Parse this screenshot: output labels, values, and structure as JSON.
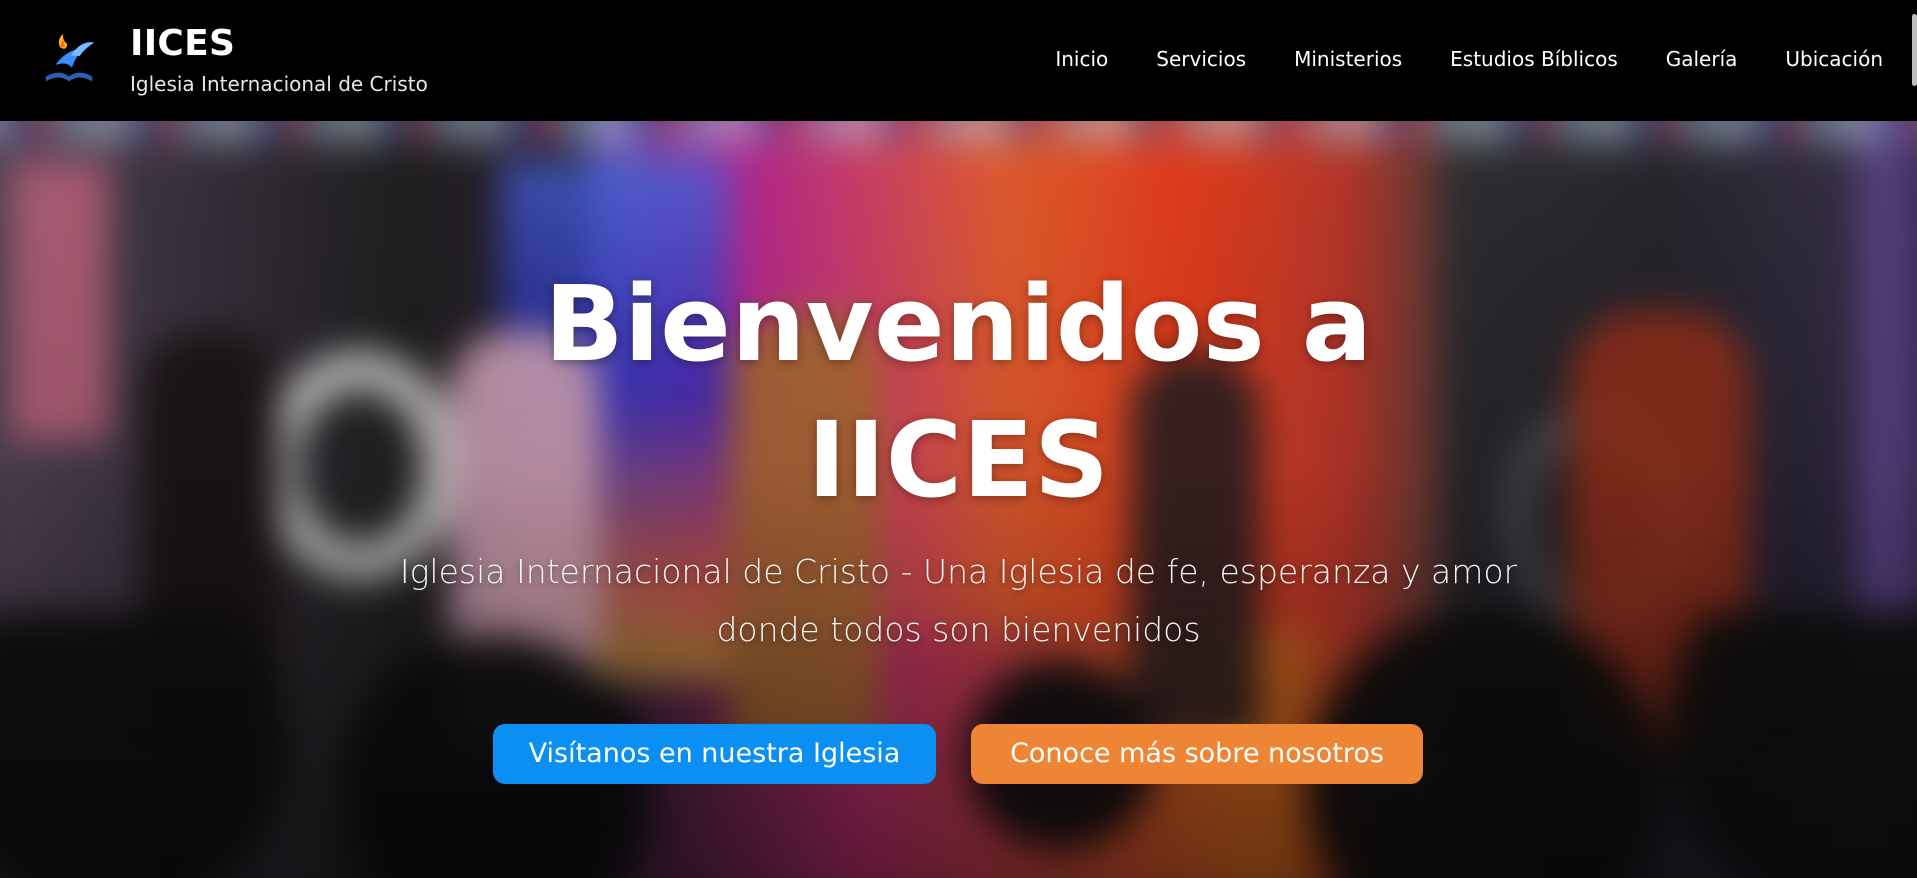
{
  "header": {
    "brand_title": "IICES",
    "brand_subtitle": "Iglesia Internacional de Cristo",
    "logo_icon": "dove-flame-bible-icon",
    "nav": [
      "Inicio",
      "Servicios",
      "Ministerios",
      "Estudios Bíblicos",
      "Galería",
      "Ubicación"
    ]
  },
  "hero": {
    "title_line1": "Bienvenidos a",
    "title_line2": "IICES",
    "subtitle": "Iglesia Internacional de Cristo - Una Iglesia de fe, esperanza y amor donde todos son bienvenidos",
    "primary_button": "Visítanos en nuestra Iglesia",
    "secondary_button": "Conoce más sobre nosotros"
  },
  "colors": {
    "header_bg": "#000000",
    "primary_button": "#0b8ff2",
    "secondary_button": "#ed8534"
  }
}
